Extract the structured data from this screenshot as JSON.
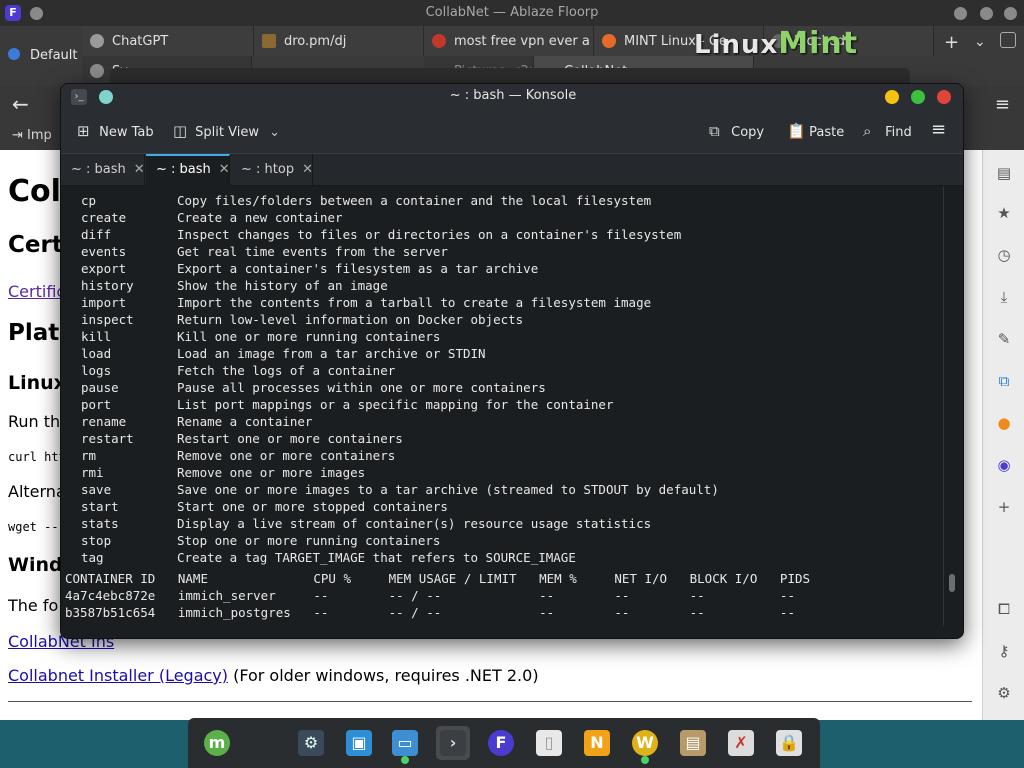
{
  "browser": {
    "window_title": "CollabNet — Ablaze Floorp",
    "app_icon_letter": "F",
    "profile": "Default",
    "tabs": [
      {
        "label": "ChatGPT",
        "color": "#9a9a9a"
      },
      {
        "label": "dro.pm/dj",
        "color": "#8a6a30"
      },
      {
        "label": "most free vpn ever a",
        "color": "#c0392b"
      },
      {
        "label": "MINT Linux - Ge",
        "color": "#e66b2b"
      },
      {
        "label": "Blocked",
        "color": "#666666"
      }
    ],
    "tabs_row2": [
      {
        "label": "Sy...",
        "color": "#8a8a8a"
      },
      {
        "label": "Pictures <2>",
        "color": "#7a7a7a"
      },
      {
        "label": "CollabNet",
        "color": "#7a7a7a"
      }
    ],
    "import_label": "Imp",
    "page": {
      "h1": "Coll",
      "h2_cert": "Cert",
      "cert_link": "Certific",
      "h2_plat": "Plat",
      "h3_linux": "Linux",
      "run_text": "Run th",
      "curl_text": "curl htt",
      "alt_text": "Alterna",
      "wget_text": "wget --",
      "h3_windows": "Wind",
      "following_text": "The fo",
      "installer_link": "CollabNet Ins",
      "legacy_link": "Collabnet Installer (Legacy)",
      "legacy_note": " (For older windows, requires .NET 2.0)"
    }
  },
  "konsole": {
    "window_title": "~ : bash — Konsole",
    "toolbar": {
      "new_tab": "New Tab",
      "split_view": "Split View",
      "copy": "Copy",
      "paste": "Paste",
      "find": "Find"
    },
    "tabs": [
      {
        "label": "~ : bash",
        "active": false
      },
      {
        "label": "~ : bash",
        "active": true
      },
      {
        "label": "~ : htop",
        "active": false
      }
    ],
    "commands": [
      {
        "name": "cp",
        "desc": "Copy files/folders between a container and the local filesystem"
      },
      {
        "name": "create",
        "desc": "Create a new container"
      },
      {
        "name": "diff",
        "desc": "Inspect changes to files or directories on a container's filesystem"
      },
      {
        "name": "events",
        "desc": "Get real time events from the server"
      },
      {
        "name": "export",
        "desc": "Export a container's filesystem as a tar archive"
      },
      {
        "name": "history",
        "desc": "Show the history of an image"
      },
      {
        "name": "import",
        "desc": "Import the contents from a tarball to create a filesystem image"
      },
      {
        "name": "inspect",
        "desc": "Return low-level information on Docker objects"
      },
      {
        "name": "kill",
        "desc": "Kill one or more running containers"
      },
      {
        "name": "load",
        "desc": "Load an image from a tar archive or STDIN"
      },
      {
        "name": "logs",
        "desc": "Fetch the logs of a container"
      },
      {
        "name": "pause",
        "desc": "Pause all processes within one or more containers"
      },
      {
        "name": "port",
        "desc": "List port mappings or a specific mapping for the container"
      },
      {
        "name": "rename",
        "desc": "Rename a container"
      },
      {
        "name": "restart",
        "desc": "Restart one or more containers"
      },
      {
        "name": "rm",
        "desc": "Remove one or more containers"
      },
      {
        "name": "rmi",
        "desc": "Remove one or more images"
      },
      {
        "name": "save",
        "desc": "Save one or more images to a tar archive (streamed to STDOUT by default)"
      },
      {
        "name": "start",
        "desc": "Start one or more stopped containers"
      },
      {
        "name": "stats",
        "desc": "Display a live stream of container(s) resource usage statistics"
      },
      {
        "name": "stop",
        "desc": "Stop one or more running containers"
      },
      {
        "name": "tag",
        "desc": "Create a tag TARGET_IMAGE that refers to SOURCE_IMAGE"
      }
    ],
    "stats_header": "CONTAINER ID   NAME              CPU %     MEM USAGE / LIMIT   MEM %     NET I/O   BLOCK I/O   PIDS",
    "stats_rows": [
      "4a7c4ebc872e   immich_server     --        -- / --             --        --        --          --",
      "b3587b51c654   immich_postgres   --        -- / --             --        --        --          --"
    ]
  },
  "desktop": {
    "logo_linux": "Linux",
    "logo_mint": "Mint"
  },
  "taskbar": {
    "items": [
      {
        "name": "mint-menu",
        "glyph": "m",
        "bg": "#5bb04a",
        "fg": "#fff"
      },
      {
        "name": "settings",
        "glyph": "⚙",
        "bg": "#3a4a5a",
        "fg": "#dfe"
      },
      {
        "name": "store",
        "glyph": "▣",
        "bg": "#2e8fd6",
        "fg": "#fff"
      },
      {
        "name": "files",
        "glyph": "▭",
        "bg": "#3d8fd1",
        "fg": "#fff"
      },
      {
        "name": "terminal",
        "glyph": "›",
        "bg": "#3b3f44",
        "fg": "#ddd"
      },
      {
        "name": "floorp",
        "glyph": "F",
        "bg": "#4b3bd1",
        "fg": "#fff"
      },
      {
        "name": "document",
        "glyph": "▯",
        "bg": "#e8e8e8",
        "fg": "#999"
      },
      {
        "name": "notes",
        "glyph": "N",
        "bg": "#f1a218",
        "fg": "#fff"
      },
      {
        "name": "w-app",
        "glyph": "W",
        "bg": "#e0b21a",
        "fg": "#fff"
      },
      {
        "name": "archive",
        "glyph": "▤",
        "bg": "#b89a6a",
        "fg": "#fff"
      },
      {
        "name": "x-tool",
        "glyph": "✗",
        "bg": "#dcdcdc",
        "fg": "#c33"
      },
      {
        "name": "lock",
        "glyph": "🔒",
        "bg": "#e0e0e0",
        "fg": "#666"
      }
    ]
  }
}
